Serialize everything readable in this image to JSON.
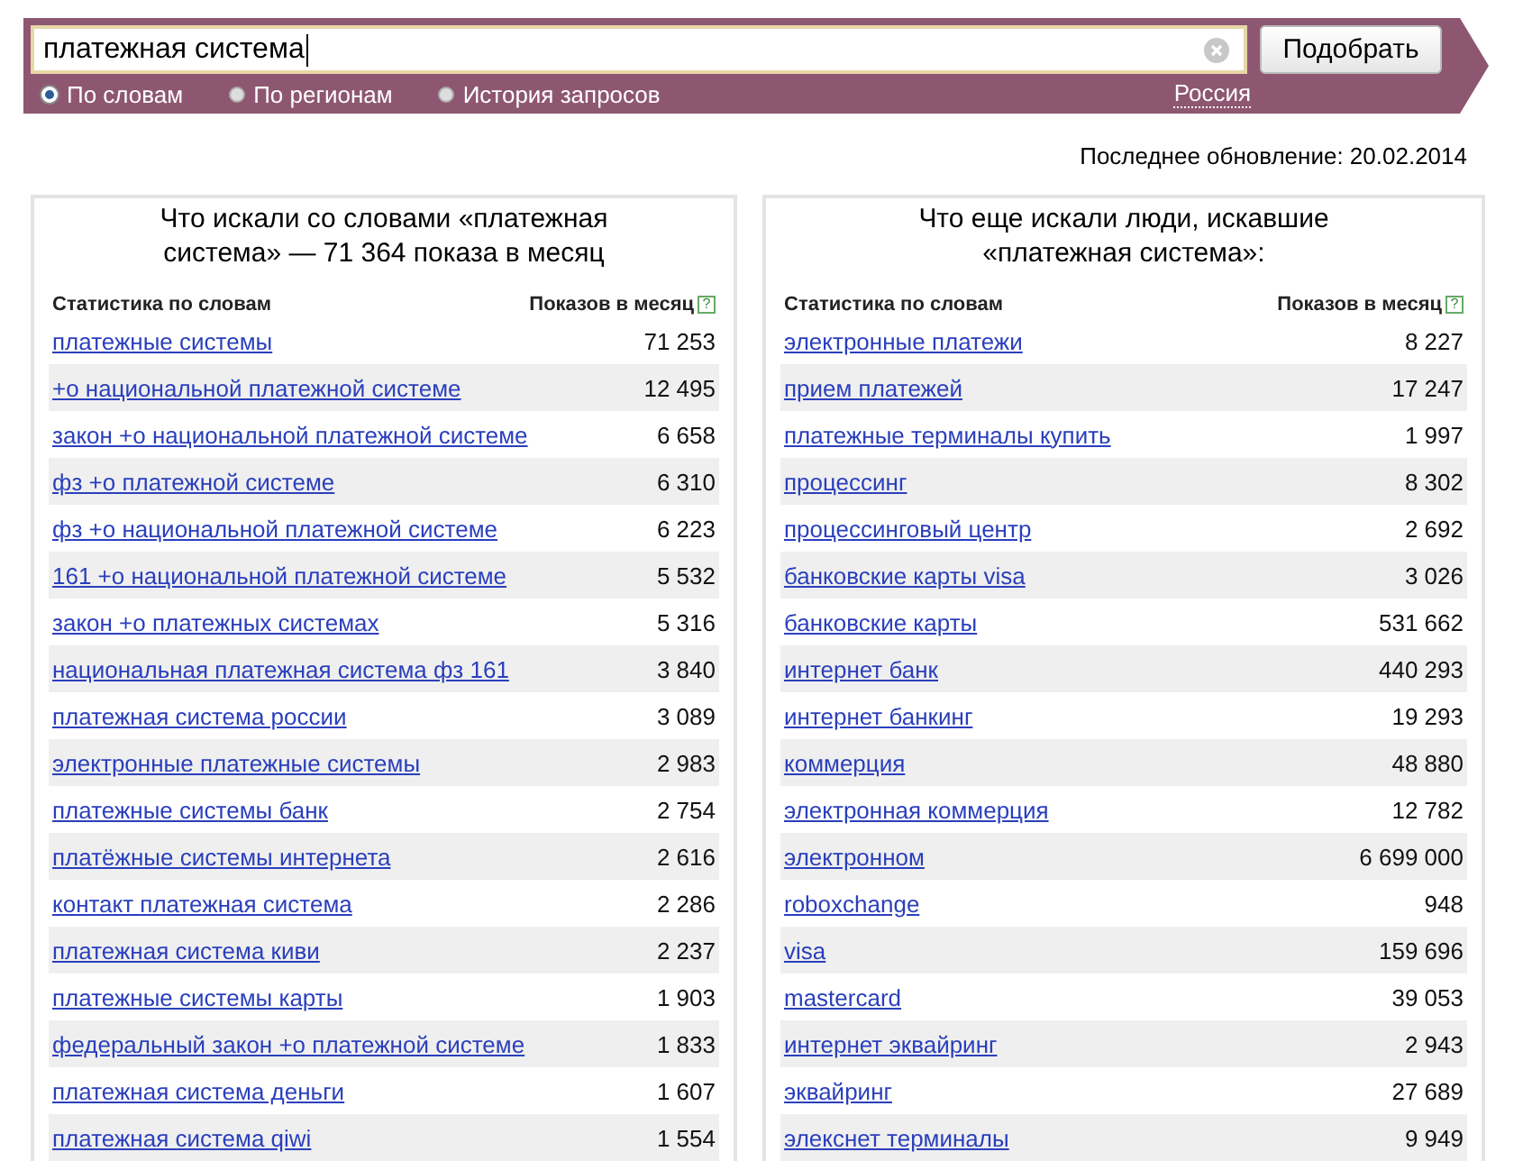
{
  "search": {
    "value": "платежная система",
    "button": "Подобрать"
  },
  "modes": [
    {
      "label": "По словам",
      "selected": true
    },
    {
      "label": "По регионам",
      "selected": false
    },
    {
      "label": "История запросов",
      "selected": false
    }
  ],
  "region": "Россия",
  "last_update": "Последнее обновление: 20.02.2014",
  "panels": [
    {
      "title": "Что искали со словами «платежная система» — 71 364 показа в месяц",
      "columns": [
        "Статистика по словам",
        "Показов в месяц"
      ],
      "help": "?",
      "rows": [
        [
          "платежные системы",
          "71 253"
        ],
        [
          "+о национальной платежной системе",
          "12 495"
        ],
        [
          "закон +о национальной платежной системе",
          "6 658"
        ],
        [
          "фз +о платежной системе",
          "6 310"
        ],
        [
          "фз +о национальной платежной системе",
          "6 223"
        ],
        [
          "161 +о национальной платежной системе",
          "5 532"
        ],
        [
          "закон +о платежных системах",
          "5 316"
        ],
        [
          "национальная платежная система фз 161",
          "3 840"
        ],
        [
          "платежная система россии",
          "3 089"
        ],
        [
          "электронные платежные системы",
          "2 983"
        ],
        [
          "платежные системы банк",
          "2 754"
        ],
        [
          "платёжные системы интернета",
          "2 616"
        ],
        [
          "контакт платежная система",
          "2 286"
        ],
        [
          "платежная система киви",
          "2 237"
        ],
        [
          "платежные системы карты",
          "1 903"
        ],
        [
          "федеральный закон +о платежной системе",
          "1 833"
        ],
        [
          "платежная система деньги",
          "1 607"
        ],
        [
          "платежная система qiwi",
          "1 554"
        ]
      ]
    },
    {
      "title": "Что еще искали люди, искавшие «платежная система»:",
      "columns": [
        "Статистика по словам",
        "Показов в месяц"
      ],
      "help": "?",
      "rows": [
        [
          "электронные платежи",
          "8 227"
        ],
        [
          "прием платежей",
          "17 247"
        ],
        [
          "платежные терминалы купить",
          "1 997"
        ],
        [
          "процессинг",
          "8 302"
        ],
        [
          "процессинговый центр",
          "2 692"
        ],
        [
          "банковские карты visa",
          "3 026"
        ],
        [
          "банковские карты",
          "531 662"
        ],
        [
          "интернет банк",
          "440 293"
        ],
        [
          "интернет банкинг",
          "19 293"
        ],
        [
          "коммерция",
          "48 880"
        ],
        [
          "электронная коммерция",
          "12 782"
        ],
        [
          "электронном",
          "6 699 000"
        ],
        [
          "roboxchange",
          "948"
        ],
        [
          "visa",
          "159 696"
        ],
        [
          "mastercard",
          "39 053"
        ],
        [
          "интернет эквайринг",
          "2 943"
        ],
        [
          "эквайринг",
          "27 689"
        ],
        [
          "элекснет терминалы",
          "9 949"
        ]
      ]
    }
  ]
}
